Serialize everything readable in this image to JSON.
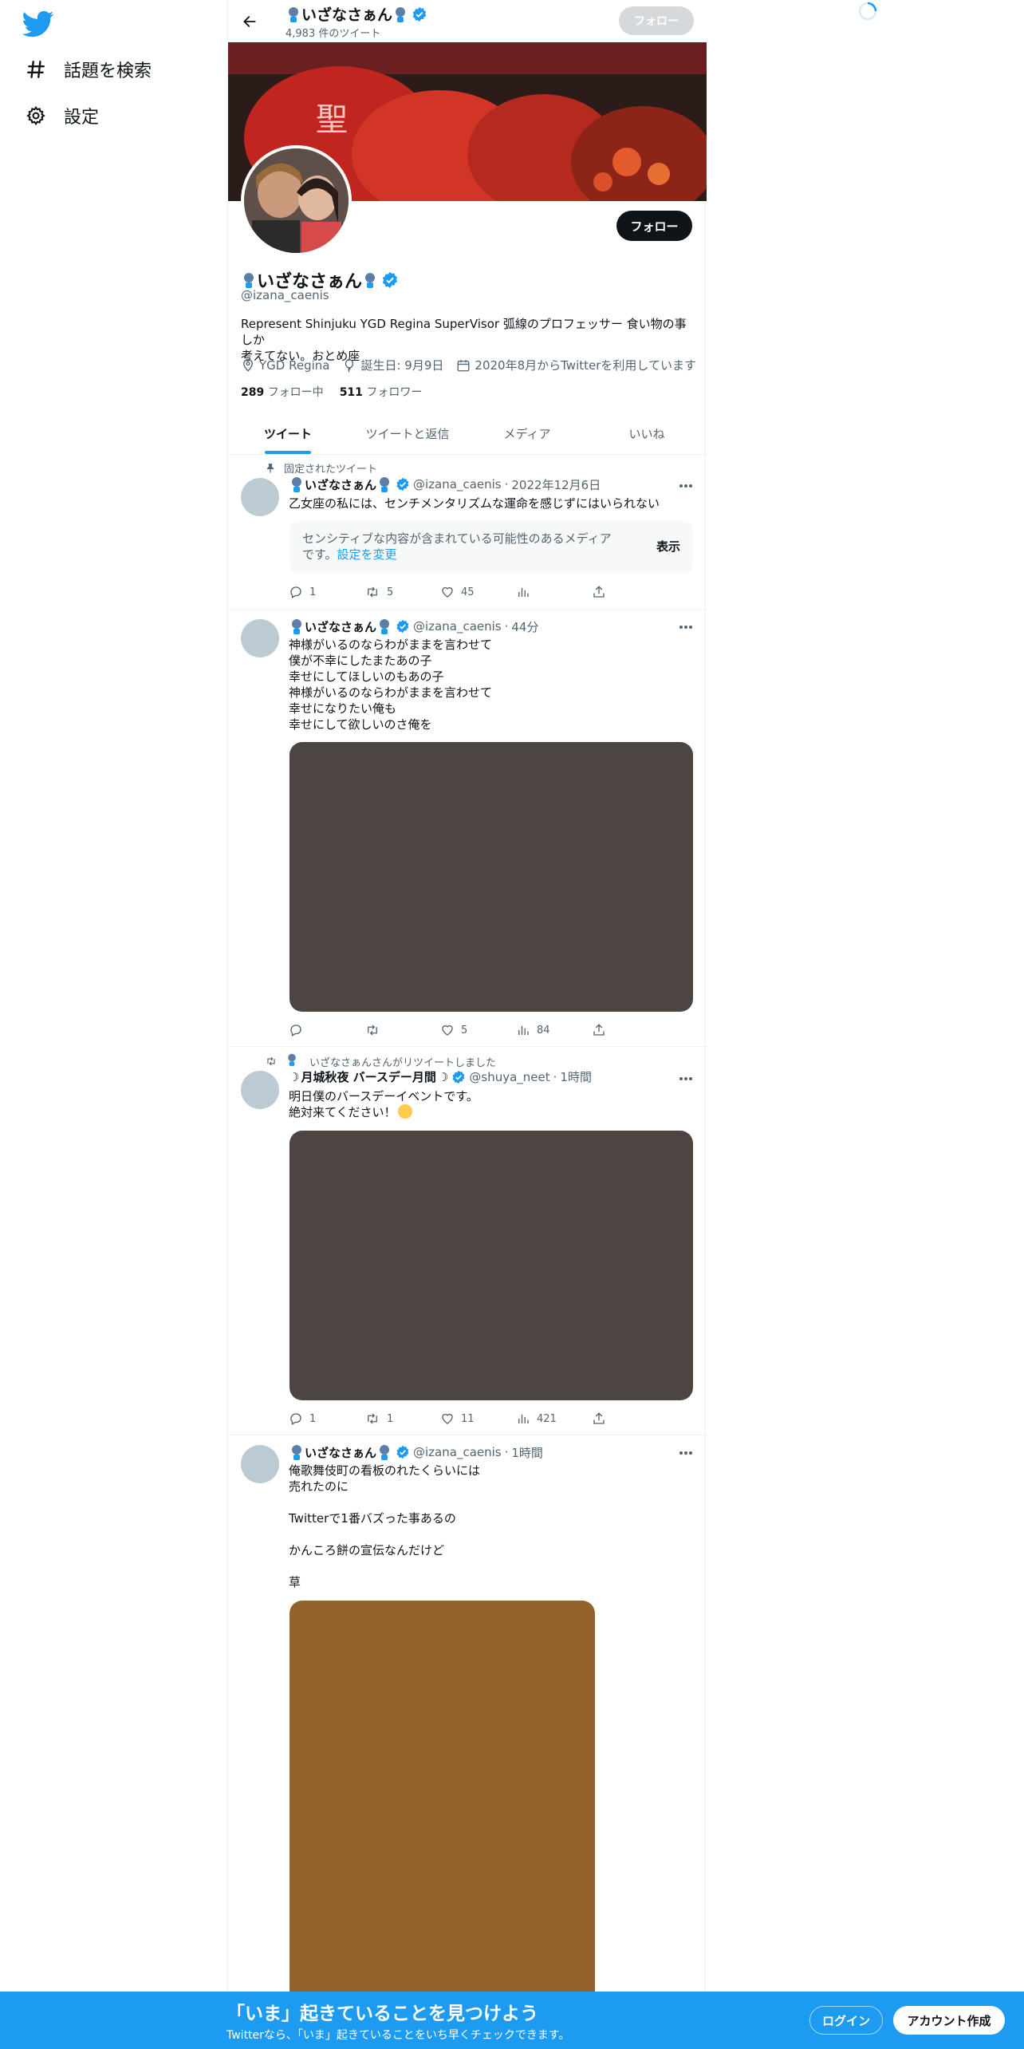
{
  "nav": {
    "items": [
      {
        "label": "話題を検索",
        "icon": "hashtag-icon"
      },
      {
        "label": "設定",
        "icon": "gear-icon"
      }
    ]
  },
  "header": {
    "name": "いざなさぁん",
    "tweet_count": "4,983 件のツイート",
    "follow_label": "フォロー"
  },
  "profile": {
    "name": "いざなさぁん",
    "handle": "@izana_caenis",
    "bio": "Represent Shinjuku YGD Regina SuperVisor 弧線のプロフェッサー 食い物の事しか\n考えてない。おとめ座",
    "location": "YGD Regina",
    "birthday": "誕生日: 9月9日",
    "joined": "2020年8月からTwitterを利用しています",
    "following_count": "289",
    "following_label": "フォロー中",
    "followers_count": "511",
    "followers_label": "フォロワー",
    "follow_label": "フォロー"
  },
  "tabs": [
    {
      "label": "ツイート",
      "active": true
    },
    {
      "label": "ツイートと返信",
      "active": false
    },
    {
      "label": "メディア",
      "active": false
    },
    {
      "label": "いいね",
      "active": false
    }
  ],
  "tweets": [
    {
      "social": "固定されたツイート",
      "name": "いざなさぁん",
      "handle": "@izana_caenis",
      "time": "2022年12月6日",
      "text": "乙女座の私には、センチメンタリズムな運命を感じずにはいられない",
      "sensitive_text": "センシティブな内容が含まれている可能性のあるメディアです。",
      "sensitive_link": "設定を変更",
      "sensitive_show": "表示",
      "replies": "1",
      "retweets": "5",
      "likes": "45",
      "views": ""
    },
    {
      "name": "いざなさぁん",
      "handle": "@izana_caenis",
      "time": "44分",
      "text": "神様がいるのならわがままを言わせて\n僕が不幸にしたまたあの子\n幸せにしてほしいのもあの子\n神様がいるのならわがままを言わせて\n幸せになりたい俺も\n幸せにして欲しいのさ俺を",
      "media_color": "#4d4541",
      "replies": "",
      "retweets": "",
      "likes": "5",
      "views": "84"
    },
    {
      "social": "いざなさぁんさんがリツイートしました",
      "name": "月城秋夜 バースデー月間",
      "handle": "@shuya_neet",
      "time": "1時間",
      "text": "明日僕のバースデーイベントです。\n絶対来てください！",
      "media_color": "#4d4541",
      "replies": "1",
      "retweets": "1",
      "likes": "11",
      "views": "421"
    },
    {
      "name": "いざなさぁん",
      "handle": "@izana_caenis",
      "time": "1時間",
      "text": "俺歌舞伎町の看板のれたくらいには\n売れたのに\n\nTwitterで1番バズった事あるの\n\nかんころ餅の宣伝なんだけど\n\n草",
      "media_color": "#93612c"
    }
  ],
  "bottom_bar": {
    "title": "「いま」起きていることを見つけよう",
    "subtitle": "Twitterなら、「いま」起きていることをいち早くチェックできます。",
    "login": "ログイン",
    "signup": "アカウント作成"
  },
  "colors": {
    "accent": "#1d9bf0",
    "text": "#0f1419",
    "muted": "#536471"
  }
}
